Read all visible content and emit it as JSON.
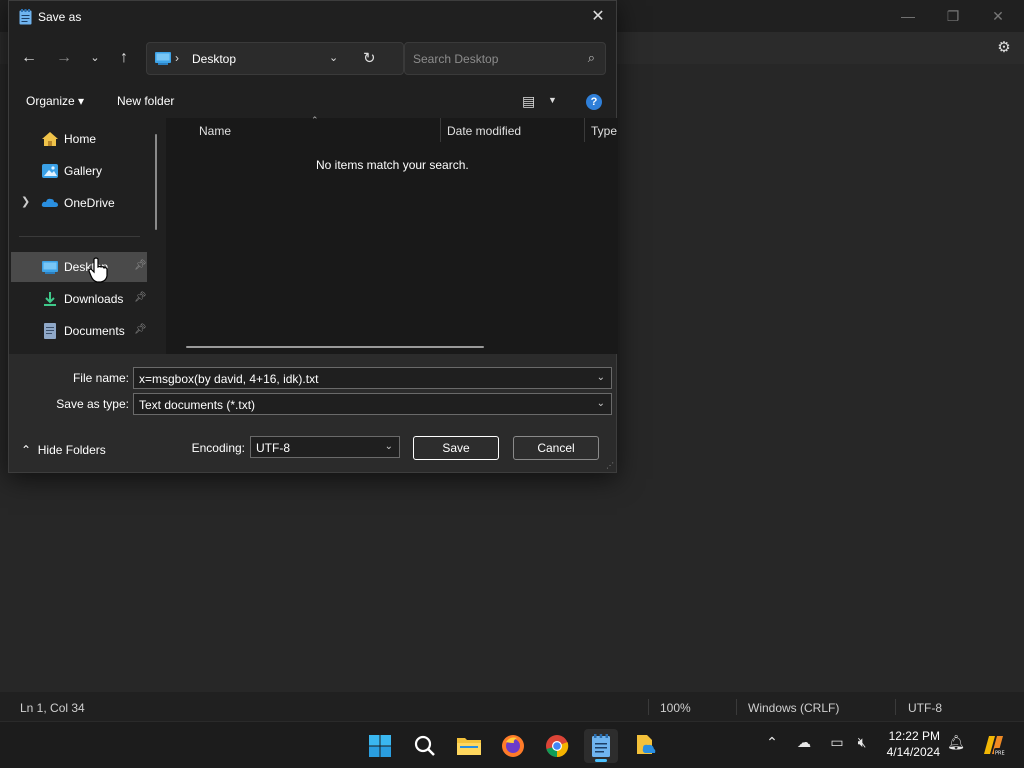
{
  "notepad": {
    "status": {
      "position": "Ln 1, Col 34",
      "zoom": "100%",
      "line_ending": "Windows (CRLF)",
      "encoding": "UTF-8"
    }
  },
  "dialog": {
    "title": "Save as",
    "address": {
      "location": "Desktop"
    },
    "search": {
      "placeholder": "Search Desktop"
    },
    "toolbar": {
      "organize": "Organize",
      "new_folder": "New folder"
    },
    "nav": [
      {
        "label": "Home",
        "icon": "home-icon"
      },
      {
        "label": "Gallery",
        "icon": "gallery-icon"
      },
      {
        "label": "OneDrive",
        "icon": "cloud-icon"
      },
      {
        "label": "Desktop",
        "icon": "desktop-icon",
        "pinned": true
      },
      {
        "label": "Downloads",
        "icon": "download-icon",
        "pinned": true
      },
      {
        "label": "Documents",
        "icon": "document-icon",
        "pinned": true
      }
    ],
    "columns": [
      "Name",
      "Date modified",
      "Type"
    ],
    "empty_message": "No items match your search.",
    "file_name_label": "File name:",
    "file_name": "x=msgbox(by david, 4+16, idk).txt",
    "save_type_label": "Save as type:",
    "save_type": "Text documents (*.txt)",
    "hide_folders": "Hide Folders",
    "encoding_label": "Encoding:",
    "encoding": "UTF-8",
    "save": "Save",
    "cancel": "Cancel"
  },
  "taskbar": {
    "apps": [
      "windows-start-icon",
      "search-icon",
      "file-explorer-icon",
      "firefox-icon",
      "chrome-icon",
      "notepad-icon",
      "file-app-icon"
    ],
    "time": "12:22 PM",
    "date": "4/14/2024"
  },
  "colors": {
    "accent": "#4cc2ff",
    "help": "#2f7fd8",
    "folder": "#f3c13a",
    "onedrive": "#2a8fe0"
  }
}
